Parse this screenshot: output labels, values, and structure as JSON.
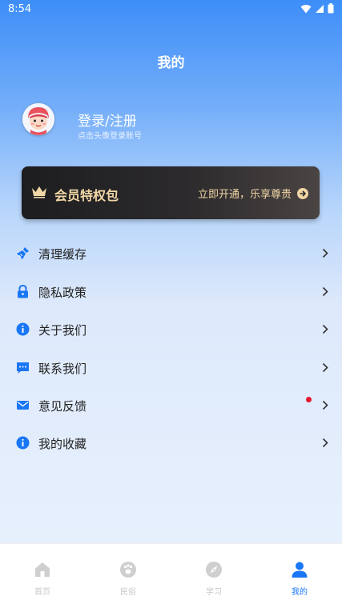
{
  "status_bar": {
    "time": "8:54"
  },
  "page": {
    "title": "我的"
  },
  "profile": {
    "login_title": "登录/注册",
    "login_subtitle": "点击头像登录账号"
  },
  "vip": {
    "title": "会员特权包",
    "action": "立即开通，乐享尊贵",
    "accent_color": "#f1d7a5"
  },
  "menu": [
    {
      "label": "清理缓存",
      "icon": "broom-icon"
    },
    {
      "label": "隐私政策",
      "icon": "lock-icon"
    },
    {
      "label": "关于我们",
      "icon": "info-icon"
    },
    {
      "label": "联系我们",
      "icon": "message-icon"
    },
    {
      "label": "意见反馈",
      "icon": "mail-icon",
      "has_badge": true
    },
    {
      "label": "我的收藏",
      "icon": "info-icon"
    }
  ],
  "tabbar": {
    "active_color": "#1976f5",
    "tabs": [
      {
        "label": "首页",
        "icon": "home-icon"
      },
      {
        "label": "民俗",
        "icon": "paw-icon"
      },
      {
        "label": "学习",
        "icon": "compass-icon"
      },
      {
        "label": "我的",
        "icon": "person-icon",
        "active": true
      }
    ]
  }
}
